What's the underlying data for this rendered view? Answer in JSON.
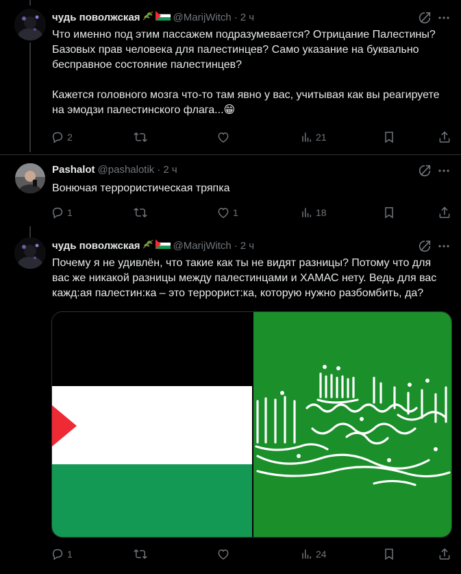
{
  "posts": [
    {
      "name": "чудь поволжская",
      "handle": "@MarijWitch",
      "sep": "·",
      "time": "2 ч",
      "text": "Что именно под этим пассажем подразумевается? Отрицание Палестины? Базовых прав человека для палестинцев? Само указание на буквально бесправное состояние палестинцев?\n\nКажется головного мозга что-то там явно у вас, учитывая как вы реагируете на эмодзи палестинского флага...😁",
      "replies": "2",
      "reposts": "",
      "likes": "",
      "views": "21"
    },
    {
      "name": "Pashalot",
      "handle": "@pashalotik",
      "sep": "·",
      "time": "2 ч",
      "text": "Вонючая террористическая тряпка",
      "replies": "1",
      "reposts": "",
      "likes": "1",
      "views": "18"
    },
    {
      "name": "чудь поволжская",
      "handle": "@MarijWitch",
      "sep": "·",
      "time": "2 ч",
      "text": "Почему я не удивлён, что такие как ты не видят разницы? Потому что для вас же никакой разницы между палестинцами и ХАМАС нету. Ведь для вас кажд:ая палестин:ка – это террорист:ка, которую нужно разбомбить, да?",
      "replies": "1",
      "reposts": "",
      "likes": "",
      "views": "24",
      "media": {
        "left": "palestine-flag",
        "right": "hamas-flag"
      }
    }
  ],
  "colors": {
    "background": "#000000",
    "text": "#e7e9ea",
    "muted": "#71767b",
    "flag_red": "#ee2a35",
    "flag_green": "#149954",
    "hamas_green": "#1a8f2a"
  },
  "icons": [
    "reply-icon",
    "repost-icon",
    "like-icon",
    "views-icon",
    "bookmark-icon",
    "share-icon",
    "grok-icon",
    "more-icon",
    "olive-branch-emoji",
    "palestine-flag-emoji"
  ]
}
